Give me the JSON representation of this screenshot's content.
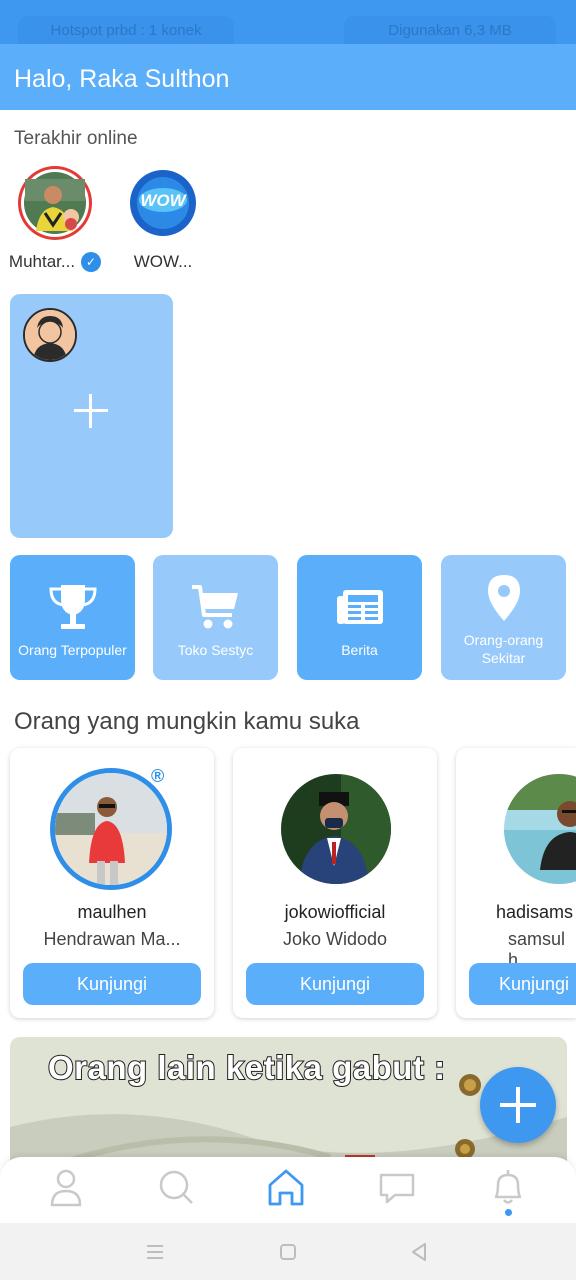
{
  "status_bar": {
    "hotspot_text": "Hotspot prbd : 1 konek",
    "data_used_text": "Digunakan 6,3 MB"
  },
  "header": {
    "title": "Halo, Raka Sulthon"
  },
  "recent_online": {
    "label": "Terakhir online",
    "users": [
      {
        "name": "Muhtar...",
        "verified": true,
        "ring_color": "#e53935"
      },
      {
        "name": "WOW...",
        "verified": false,
        "logo_text": "WOW"
      }
    ]
  },
  "story": {
    "add_icon": "plus-icon"
  },
  "menu": [
    {
      "label": "Orang Terpopuler",
      "icon": "trophy-icon"
    },
    {
      "label": "Toko Sestyc",
      "icon": "cart-icon"
    },
    {
      "label": "Berita",
      "icon": "newspaper-icon"
    },
    {
      "label": "Orang-orang Sekitar",
      "icon": "location-pin-icon"
    }
  ],
  "suggestions": {
    "label": "Orang yang mungkin kamu suka",
    "people": [
      {
        "username": "maulhen",
        "full_name": "Hendrawan Ma...",
        "button": "Kunjungi"
      },
      {
        "username": "jokowiofficial",
        "full_name": "Joko Widodo",
        "button": "Kunjungi"
      },
      {
        "username": "hadisams",
        "full_name": "samsul h",
        "button": "Kunjungi"
      }
    ],
    "badge_text": "®"
  },
  "post": {
    "caption": "Orang lain ketika gabut :"
  },
  "bottom_nav": [
    "profile-icon",
    "search-icon",
    "home-icon",
    "chat-icon",
    "bell-icon"
  ],
  "colors": {
    "primary": "#5aaefa",
    "light": "#97c9fb",
    "status": "#3f98f0"
  }
}
